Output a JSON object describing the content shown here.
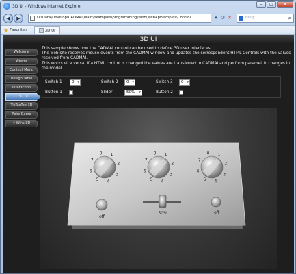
{
  "window": {
    "title": "3D UI - Windows Internet Explorer"
  },
  "address": {
    "url": "D:\\Data\\Develop\\CADMAI\\Main\\examples\\programming\\Web\\WebApiSamples\\Control"
  },
  "search": {
    "placeholder": "Bing"
  },
  "favorites": {
    "label": "Favoriten"
  },
  "tab": {
    "title": "3D UI"
  },
  "page": {
    "header": "3D UI",
    "desc": [
      "This sample shows how the CADMAI control can be used to define 3D user interfaces",
      "The web site receives mouse events from the CADMAI window and updates the correspondent HTML Controls with the values received from CADMAI.",
      "This works vice versa. If a HTML control is changed the values are transferred to CADMAI and perform parametric changes in the model"
    ]
  },
  "sidebar": {
    "items": [
      {
        "label": "Welcome",
        "active": false
      },
      {
        "label": "Viewer",
        "active": false
      },
      {
        "label": "Context Menu",
        "active": false
      },
      {
        "label": "Design Table",
        "active": false
      },
      {
        "label": "Interaction",
        "active": false
      },
      {
        "label": "3D UI",
        "active": true
      },
      {
        "label": "TicTacToe 3D",
        "active": false
      },
      {
        "label": "Poke Game",
        "active": false
      },
      {
        "label": "4 Wins 3D",
        "active": false
      }
    ]
  },
  "controls": {
    "switch1": {
      "label": "Switch 1",
      "value": "0"
    },
    "switch2": {
      "label": "Switch 2",
      "value": "0"
    },
    "switch3": {
      "label": "Switch 3",
      "value": "0"
    },
    "button1": {
      "label": "Button 1",
      "checked": false
    },
    "slider": {
      "label": "Slider",
      "value": "50%"
    },
    "button2": {
      "label": "Button 2",
      "checked": false
    }
  },
  "scene": {
    "knob_numbers": [
      "0",
      "1",
      "2",
      "3",
      "4",
      "5",
      "6",
      "7"
    ],
    "button1_text": "off",
    "slider_text": "50%",
    "button2_text": "off"
  }
}
